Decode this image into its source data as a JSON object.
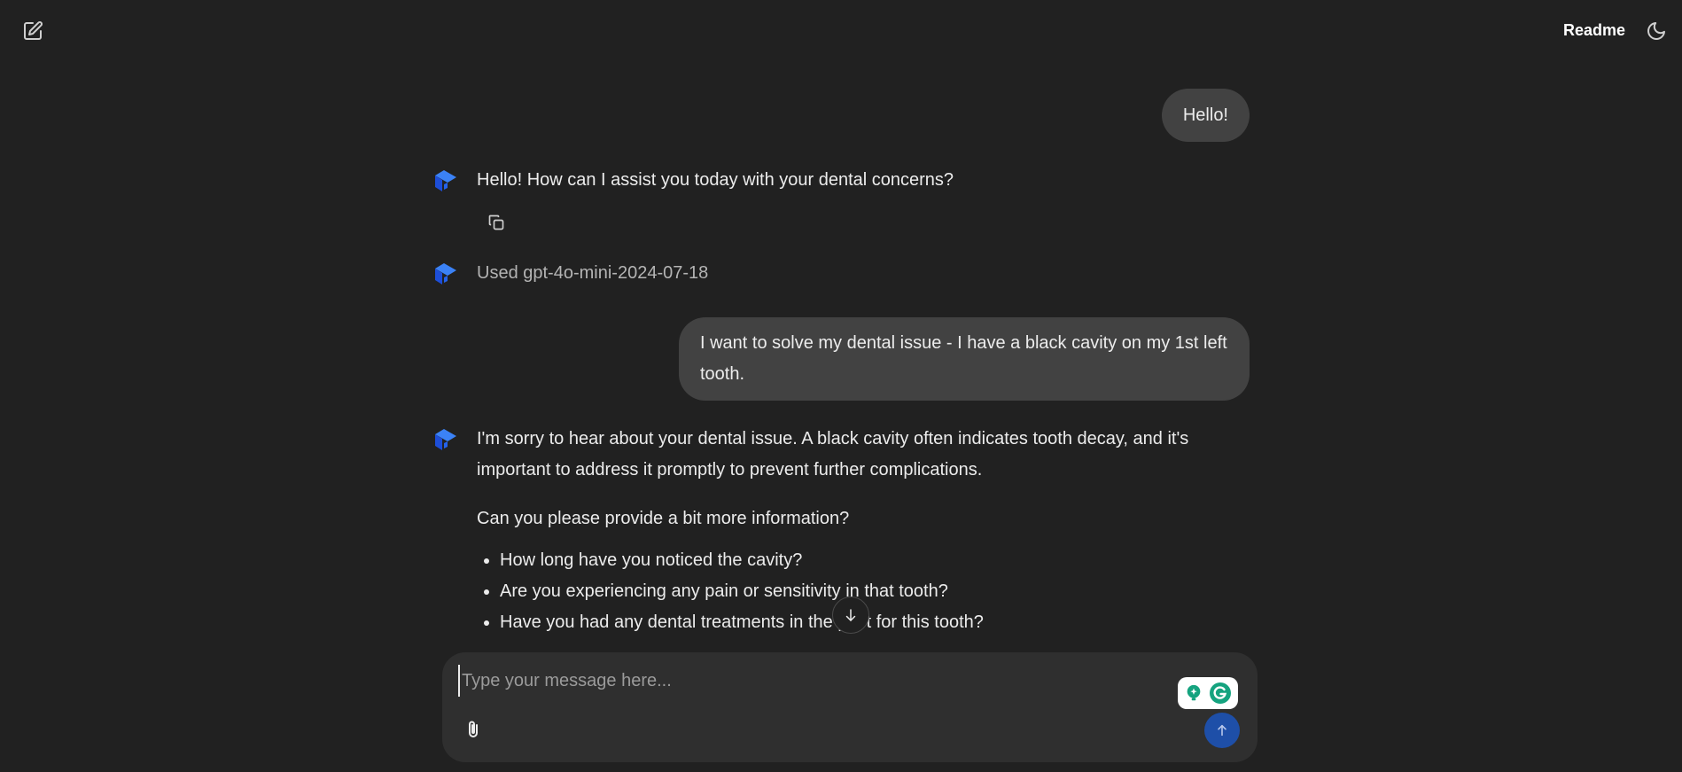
{
  "header": {
    "new_chat_icon": "edit-square-icon",
    "readme_label": "Readme",
    "theme_icon": "moon-icon"
  },
  "messages": [
    {
      "role": "user",
      "text": "Hello!"
    },
    {
      "role": "assistant",
      "paragraphs": [
        "Hello! How can I assist you today with your dental concerns?"
      ],
      "copy_icon": "copy-icon"
    },
    {
      "role": "assistant-note",
      "text": "Used gpt-4o-mini-2024-07-18"
    },
    {
      "role": "user",
      "text": "I want to solve my dental issue - I have a black cavity on my 1st left tooth."
    },
    {
      "role": "assistant",
      "paragraphs": [
        "I'm sorry to hear about your dental issue. A black cavity often indicates tooth decay, and it's important to address it promptly to prevent further complications.",
        "Can you please provide a bit more information?"
      ],
      "bullets": [
        "How long have you noticed the cavity?",
        "Are you experiencing any pain or sensitivity in that tooth?",
        "Have you had any dental treatments in the past for this tooth?"
      ]
    }
  ],
  "composer": {
    "placeholder": "Type your message here...",
    "attach_icon": "paperclip-icon",
    "send_icon": "arrow-up-icon"
  },
  "colors": {
    "background": "#212121",
    "user_bubble": "#424242",
    "composer": "#2f2f2f",
    "accent": "#2f6fe8",
    "send_button": "#1e4fa8"
  }
}
